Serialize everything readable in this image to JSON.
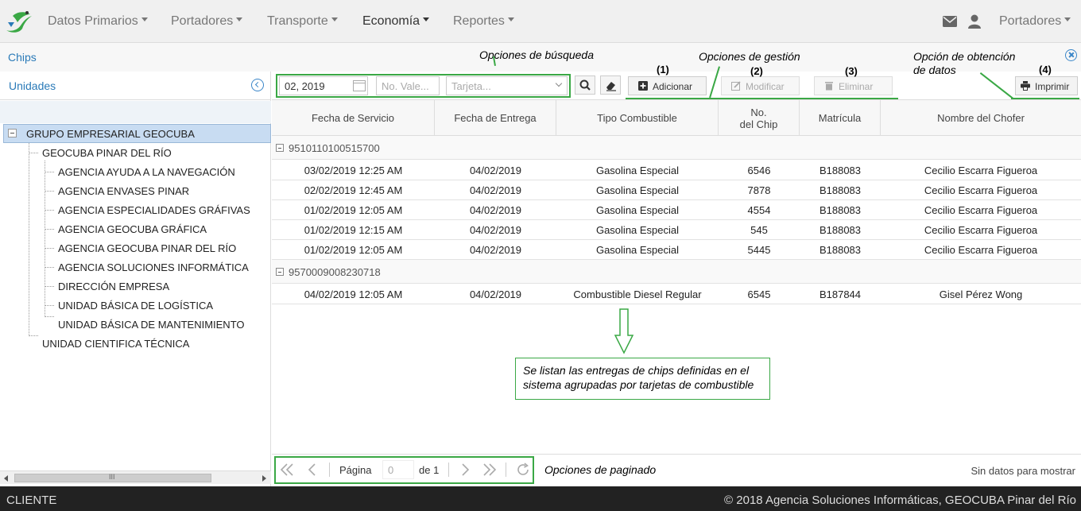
{
  "navbar": {
    "menu": [
      "Datos Primarios",
      "Portadores",
      "Transporte",
      "Economía",
      "Reportes"
    ],
    "active": "Economía",
    "user_menu": "Portadores",
    "icons": [
      "logo-icon",
      "mail-icon",
      "user-icon"
    ]
  },
  "page": {
    "title": "Chips"
  },
  "left_panel": {
    "header": "Unidades",
    "tree": {
      "root": "GRUPO EMPRESARIAL GEOCUBA",
      "level1": [
        "GEOCUBA PINAR DEL RÍO",
        "UNIDAD CIENTIFICA TÉCNICA"
      ],
      "level2": [
        "AGENCIA AYUDA A LA NAVEGACIÓN",
        "AGENCIA ENVASES PINAR",
        "AGENCIA ESPECIALIDADES GRÁFIVAS",
        "AGENCIA GEOCUBA GRÁFICA",
        "AGENCIA GEOCUBA PINAR DEL RÍO",
        "AGENCIA SOLUCIONES INFORMÁTICA",
        "DIRECCIÓN EMPRESA",
        "UNIDAD BÁSICA DE LOGÍSTICA",
        "UNIDAD BÁSICA DE MANTENIMIENTO"
      ]
    },
    "scroll_thumb_label": "III"
  },
  "toolbar": {
    "date_value": "02, 2019",
    "vale_placeholder": "No. Vale...",
    "tarjeta_placeholder": "Tarjeta...",
    "add_label": "Adicionar",
    "edit_label": "Modificar",
    "delete_label": "Eliminar",
    "print_label": "Imprimir"
  },
  "annotations": {
    "search": "Opciones de búsqueda",
    "management": "Opciones de gestión",
    "data_line1": "Opción de obtención",
    "data_line2": "de datos",
    "n1": "(1)",
    "n2": "(2)",
    "n3": "(3)",
    "n4": "(4)",
    "callout_line1": "Se listan las entregas de chips definidas en el",
    "callout_line2": "sistema agrupadas por tarjetas de combustible",
    "paging": "Opciones de paginado"
  },
  "grid": {
    "columns": [
      "Fecha de Servicio",
      "Fecha de Entrega",
      "Tipo Combustible",
      "No.",
      "del Chip",
      "Matrícula",
      "Nombre del Chofer"
    ],
    "groups": [
      {
        "card": "9510110100515700",
        "rows": [
          [
            "03/02/2019 12:25 AM",
            "04/02/2019",
            "Gasolina Especial",
            "6546",
            "B188083",
            "Cecilio Escarra Figueroa"
          ],
          [
            "02/02/2019 12:45 AM",
            "04/02/2019",
            "Gasolina Especial",
            "7878",
            "B188083",
            "Cecilio Escarra Figueroa"
          ],
          [
            "01/02/2019 12:05 AM",
            "04/02/2019",
            "Gasolina Especial",
            "4554",
            "B188083",
            "Cecilio Escarra Figueroa"
          ],
          [
            "01/02/2019 12:15 AM",
            "04/02/2019",
            "Gasolina Especial",
            "545",
            "B188083",
            "Cecilio Escarra Figueroa"
          ],
          [
            "01/02/2019 12:05 AM",
            "04/02/2019",
            "Gasolina Especial",
            "5445",
            "B188083",
            "Cecilio Escarra Figueroa"
          ]
        ]
      },
      {
        "card": "9570009008230718",
        "rows": [
          [
            "04/02/2019 12:05 AM",
            "04/02/2019",
            "Combustible Diesel Regular",
            "6545",
            "B187844",
            "Gisel Pérez Wong"
          ]
        ]
      }
    ]
  },
  "pager": {
    "page_label": "Página",
    "page_value": "0",
    "of_label": "de 1",
    "empty_message": "Sin datos para mostrar"
  },
  "footer": {
    "left": "CLIENTE",
    "right": "© 2018 Agencia Soluciones Informáticas, GEOCUBA Pinar del Río"
  },
  "colors": {
    "annotation_green": "#3aa845",
    "link_blue": "#2a7ab8",
    "footer_bg": "#222222"
  }
}
